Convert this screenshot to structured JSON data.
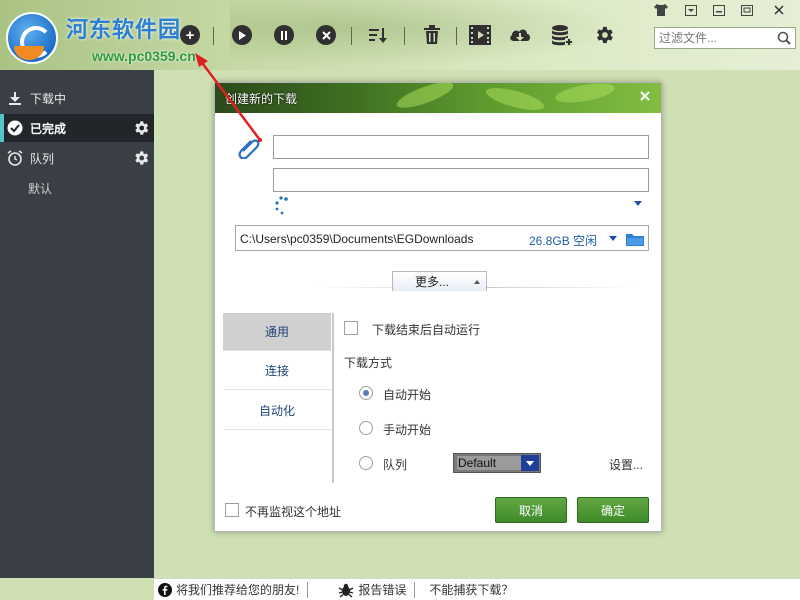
{
  "watermark": {
    "brand": "河东软件园",
    "url": "www.pc0359.cn"
  },
  "toolbar": {
    "buttons": [
      {
        "name": "add",
        "icon": "plus-icon"
      },
      {
        "name": "start",
        "icon": "play-icon"
      },
      {
        "name": "pause",
        "icon": "pause-icon"
      },
      {
        "name": "stop",
        "icon": "stop-icon"
      },
      {
        "name": "sort",
        "icon": "sort-icon"
      },
      {
        "name": "delete",
        "icon": "trash-icon"
      },
      {
        "name": "video",
        "icon": "film-icon"
      },
      {
        "name": "cloud",
        "icon": "cloud-download-icon"
      },
      {
        "name": "database",
        "icon": "database-icon"
      },
      {
        "name": "settings",
        "icon": "gear-icon"
      }
    ],
    "filter_placeholder": "过滤文件..."
  },
  "window_controls": [
    "skin-icon",
    "menu-icon",
    "minimize-icon",
    "maximize-icon",
    "close-icon"
  ],
  "sidebar": {
    "items": [
      {
        "label": "下载中",
        "icon": "download-icon",
        "active": false
      },
      {
        "label": "已完成",
        "icon": "check-circle-icon",
        "active": true
      },
      {
        "label": "队列",
        "icon": "alarm-clock-icon",
        "active": false
      }
    ],
    "sub_items": [
      "默认"
    ]
  },
  "dialog": {
    "title": "创建新的下载",
    "url_value": "",
    "name_value": "",
    "save_path": "C:\\Users\\pc0359\\Documents\\EGDownloads",
    "free_space": "26.8GB 空闲",
    "more_label": "更多...",
    "tabs": [
      "通用",
      "连接",
      "自动化"
    ],
    "selected_tab": 0,
    "run_after_label": "下载结束后自动运行",
    "mode_label": "下载方式",
    "modes": [
      "自动开始",
      "手动开始",
      "队列"
    ],
    "selected_mode": 0,
    "queue_value": "Default",
    "settings_link": "设置...",
    "no_monitor_label": "不再监视这个地址",
    "cancel_label": "取消",
    "ok_label": "确定"
  },
  "statusbar": {
    "recommend": "将我们推荐给您的朋友!",
    "report": "报告错误",
    "cant_capture": "不能捕获下载？"
  },
  "colors": {
    "sidebar_bg": "#3a3f45",
    "accent": "#58c4c8",
    "button_green": "#4f9a35",
    "link_blue": "#1f5fa8"
  }
}
